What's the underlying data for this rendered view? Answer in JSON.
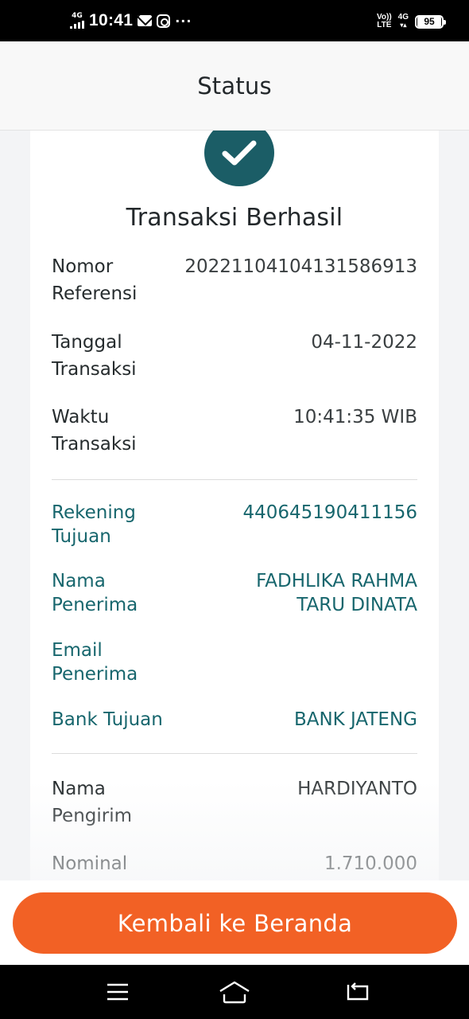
{
  "status_bar": {
    "signal_label": "4G",
    "time": "10:41",
    "volte_line1": "Vo))",
    "volte_line2": "LTE",
    "network": "4G",
    "battery": "95"
  },
  "header": {
    "title": "Status"
  },
  "receipt": {
    "title": "Transaksi Berhasil",
    "transaction_rows": [
      {
        "label": "Nomor Referensi",
        "value": "20221104104131586913"
      },
      {
        "label": "Tanggal Transaksi",
        "value": "04-11-2022"
      },
      {
        "label": "Waktu Transaksi",
        "value": "10:41:35 WIB"
      }
    ],
    "recipient_rows": [
      {
        "label": "Rekening Tujuan",
        "value": "440645190411156"
      },
      {
        "label": "Nama Penerima",
        "value": "FADHLIKA RAHMA TARU DINATA"
      },
      {
        "label": "Email Penerima",
        "value": ""
      },
      {
        "label": "Bank Tujuan",
        "value": "BANK JATENG"
      }
    ],
    "sender_rows": [
      {
        "label": "Nama Pengirim",
        "value": "HARDIYANTO"
      },
      {
        "label": "Nominal",
        "value": "1.710.000"
      }
    ]
  },
  "actions": {
    "home_button_label": "Kembali ke Beranda"
  },
  "colors": {
    "accent_teal": "#1b5d66",
    "button_orange": "#f26125"
  },
  "nav": {
    "icons": [
      "menu-icon",
      "home-icon",
      "back-icon"
    ]
  }
}
